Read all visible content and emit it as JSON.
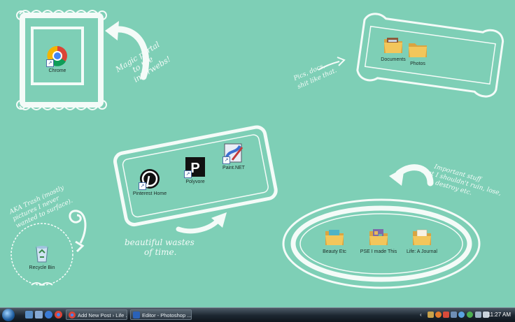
{
  "desktop": {
    "background": "#7ecfb6",
    "annotations": [
      {
        "id": "magic",
        "lines": [
          "Magic portal",
          "to the",
          "interwebs!"
        ]
      },
      {
        "id": "pics",
        "lines": [
          "Pics, docs,",
          "shit like that."
        ]
      },
      {
        "id": "trash",
        "lines": [
          "AKA Trash (mostly",
          "pictures I never",
          "wanted to surface)."
        ]
      },
      {
        "id": "wastes",
        "lines": [
          "beautiful wastes",
          "of time."
        ]
      },
      {
        "id": "important",
        "lines": [
          "Important stuff",
          "that I shouldn't ruin, lose,",
          "destroy etc."
        ]
      }
    ],
    "icons": [
      {
        "name": "chrome",
        "label": "Chrome",
        "icon": "chrome-icon"
      },
      {
        "name": "documents",
        "label": "Documents",
        "icon": "folder-icon"
      },
      {
        "name": "photos",
        "label": "Photos",
        "icon": "folder-icon"
      },
      {
        "name": "pinterest",
        "label": "Pinterest Home",
        "icon": "pinterest-icon"
      },
      {
        "name": "polyvore",
        "label": "Polyvore",
        "icon": "polyvore-icon"
      },
      {
        "name": "paintnet",
        "label": "Paint.NET",
        "icon": "paint-net-icon"
      },
      {
        "name": "recycle",
        "label": "Recycle Bin",
        "icon": "recycle-bin-icon"
      },
      {
        "name": "beauty",
        "label": "Beauty Etc",
        "icon": "folder-icon"
      },
      {
        "name": "pse",
        "label": "PSE I made This",
        "icon": "folder-icon"
      },
      {
        "name": "journal",
        "label": "Life: A Journal",
        "icon": "folder-icon"
      }
    ]
  },
  "taskbar": {
    "tasks": [
      {
        "label": "Add New Post › Life ...",
        "icon": "chrome-icon"
      },
      {
        "label": "Editor - Photoshop ...",
        "icon": "photoshop-icon"
      }
    ],
    "clock": "11:27 AM"
  }
}
